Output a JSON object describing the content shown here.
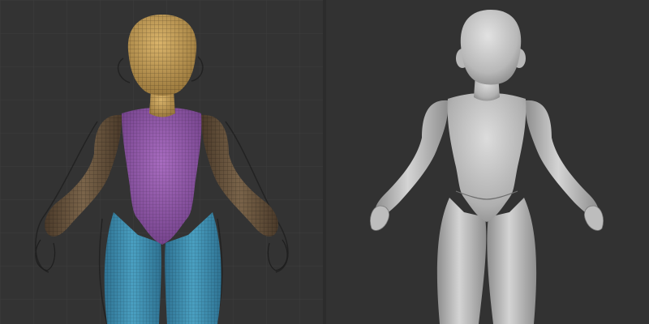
{
  "scene": {
    "left_view": "wireframe-polygroups",
    "right_view": "smooth-clay-render",
    "colors": {
      "viewport_bg": "#333333",
      "grid_line": "#3d3d3d",
      "head": "#c9a25a",
      "torso": "#9a5cb0",
      "arms": "#6b5640",
      "legs": "#3f8fb0",
      "clay": "#b5b5b5"
    }
  }
}
